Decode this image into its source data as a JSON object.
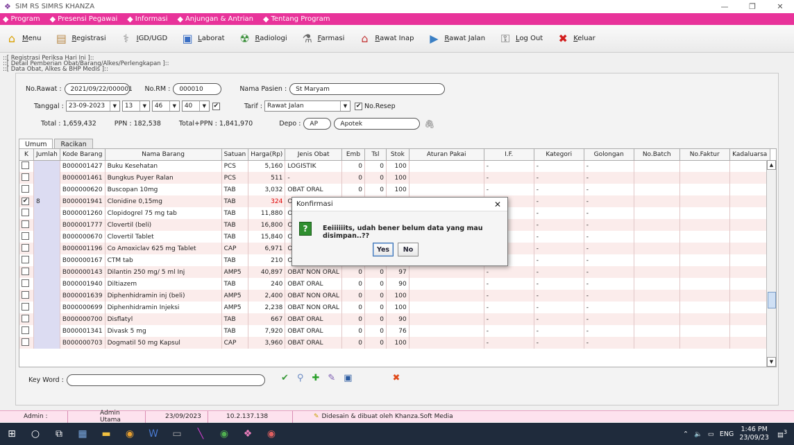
{
  "window": {
    "title": "SIM RS SIMRS KHANZA"
  },
  "menubar": [
    {
      "label": "Program",
      "icon": "program-icon"
    },
    {
      "label": "Presensi Pegawai",
      "icon": "user-icon"
    },
    {
      "label": "Informasi",
      "icon": "info-icon"
    },
    {
      "label": "Anjungan & Antrian",
      "icon": "kiosk-icon"
    },
    {
      "label": "Tentang Program",
      "icon": "about-icon"
    }
  ],
  "toolbar": [
    {
      "label": "Menu",
      "icon": "home-icon",
      "color": "#d9a000"
    },
    {
      "label": "Registrasi",
      "icon": "register-icon",
      "color": "#b98a4a"
    },
    {
      "label": "IGD/UGD",
      "icon": "emergency-icon",
      "color": "#8a8a8a"
    },
    {
      "label": "Laborat",
      "icon": "lab-icon",
      "color": "#3b6fc4"
    },
    {
      "label": "Radiologi",
      "icon": "radiology-icon",
      "color": "#3a8f3a"
    },
    {
      "label": "Farmasi",
      "icon": "pharmacy-icon",
      "color": "#6a6a6a"
    },
    {
      "label": "Rawat Inap",
      "icon": "inpatient-icon",
      "color": "#c43a3a"
    },
    {
      "label": "Rawat Jalan",
      "icon": "outpatient-icon",
      "color": "#3a7fc4"
    },
    {
      "label": "Log Out",
      "icon": "logout-icon",
      "color": "#555555"
    },
    {
      "label": "Keluar",
      "icon": "exit-icon",
      "color": "#d21e1e"
    }
  ],
  "breadcrumbs": [
    "::[ Registrasi Periksa Hari Ini ]::",
    "::[ Detail Pemberian Obat/Barang/Alkes/Perlengkapan ]::",
    "::[ Data Obat, Alkes & BHP Medis ]::"
  ],
  "form": {
    "no_rawat_label": "No.Rawat :",
    "no_rawat": "2021/09/22/000001",
    "no_rm_label": "No.RM :",
    "no_rm": "000010",
    "nama_label": "Nama Pasien :",
    "nama": "St Maryam",
    "tanggal_label": "Tanggal :",
    "tanggal": "23-09-2023",
    "jam": "13",
    "menit": "46",
    "detik": "40",
    "tarif_label": "Tarif :",
    "tarif": "Rawat Jalan",
    "noresep_label": "No.Resep",
    "total": "Total : 1,659,432",
    "ppn": "PPN : 182,538",
    "totalppn": "Total+PPN : 1,841,970",
    "depo_label": "Depo :",
    "depo_code": "AP",
    "depo_name": "Apotek"
  },
  "tabs": [
    "Umum",
    "Racikan"
  ],
  "table": {
    "headers": [
      "K",
      "Jumlah",
      "Kode Barang",
      "Nama Barang",
      "Satuan",
      "Harga(Rp)",
      "Jenis Obat",
      "Emb",
      "Tsl",
      "Stok",
      "Aturan Pakai",
      "I.F.",
      "Kategori",
      "Golongan",
      "No.Batch",
      "No.Faktur",
      "Kadaluarsa"
    ],
    "rows": [
      {
        "k": "",
        "jumlah": "",
        "kode": "B000001427",
        "nama": "Buku Kesehatan",
        "satuan": "PCS",
        "harga": "5,160",
        "jenis": "LOGISTIK",
        "emb": "0",
        "tsl": "0",
        "stok": "100",
        "aturan": "",
        "if": "-",
        "kategori": "-",
        "golongan": "-"
      },
      {
        "k": "",
        "jumlah": "",
        "kode": "B000001461",
        "nama": "Bungkus Puyer Ralan",
        "satuan": "PCS",
        "harga": "511",
        "jenis": "-",
        "emb": "0",
        "tsl": "0",
        "stok": "100",
        "aturan": "",
        "if": "-",
        "kategori": "-",
        "golongan": "-"
      },
      {
        "k": "",
        "jumlah": "",
        "kode": "B000000620",
        "nama": "Buscopan 10mg",
        "satuan": "TAB",
        "harga": "3,032",
        "jenis": "OBAT ORAL",
        "emb": "0",
        "tsl": "0",
        "stok": "100",
        "aturan": "",
        "if": "-",
        "kategori": "-",
        "golongan": "-"
      },
      {
        "k": "✔",
        "jumlah": "8",
        "kode": "B000001941",
        "nama": "Clonidine 0,15mg",
        "satuan": "TAB",
        "harga": "324",
        "jenis": "O",
        "emb": "",
        "tsl": "",
        "stok": "",
        "aturan": "",
        "if": "",
        "kategori": "-",
        "golongan": "-",
        "red": true
      },
      {
        "k": "",
        "jumlah": "",
        "kode": "B000001260",
        "nama": "Clopidogrel 75 mg tab",
        "satuan": "TAB",
        "harga": "11,880",
        "jenis": "O",
        "emb": "",
        "tsl": "",
        "stok": "",
        "aturan": "",
        "if": "",
        "kategori": "-",
        "golongan": "-"
      },
      {
        "k": "",
        "jumlah": "",
        "kode": "B000001777",
        "nama": "Clovertil (beli)",
        "satuan": "TAB",
        "harga": "16,800",
        "jenis": "O",
        "emb": "",
        "tsl": "",
        "stok": "",
        "aturan": "",
        "if": "",
        "kategori": "-",
        "golongan": "-"
      },
      {
        "k": "",
        "jumlah": "",
        "kode": "B000000670",
        "nama": "Clovertil Tablet",
        "satuan": "TAB",
        "harga": "15,840",
        "jenis": "O",
        "emb": "",
        "tsl": "",
        "stok": "",
        "aturan": "",
        "if": "",
        "kategori": "-",
        "golongan": "-"
      },
      {
        "k": "",
        "jumlah": "",
        "kode": "B000001196",
        "nama": "Co Amoxiclav 625 mg Tablet",
        "satuan": "CAP",
        "harga": "6,971",
        "jenis": "O",
        "emb": "",
        "tsl": "",
        "stok": "",
        "aturan": "",
        "if": "",
        "kategori": "-",
        "golongan": "-"
      },
      {
        "k": "",
        "jumlah": "",
        "kode": "B000000167",
        "nama": "CTM tab",
        "satuan": "TAB",
        "harga": "210",
        "jenis": "OBAT ORAL",
        "emb": "0",
        "tsl": "0",
        "stok": "1,000",
        "aturan": "",
        "if": "-",
        "kategori": "-",
        "golongan": "-"
      },
      {
        "k": "",
        "jumlah": "",
        "kode": "B000000143",
        "nama": "Dilantin 250 mg/ 5 ml Inj",
        "satuan": "AMP5",
        "harga": "40,897",
        "jenis": "OBAT NON ORAL",
        "emb": "0",
        "tsl": "0",
        "stok": "97",
        "aturan": "",
        "if": "-",
        "kategori": "-",
        "golongan": "-"
      },
      {
        "k": "",
        "jumlah": "",
        "kode": "B000001940",
        "nama": "Diltiazem",
        "satuan": "TAB",
        "harga": "240",
        "jenis": "OBAT ORAL",
        "emb": "0",
        "tsl": "0",
        "stok": "90",
        "aturan": "",
        "if": "-",
        "kategori": "-",
        "golongan": "-"
      },
      {
        "k": "",
        "jumlah": "",
        "kode": "B000001639",
        "nama": "Diphenhidramin inj (beli)",
        "satuan": "AMP5",
        "harga": "2,400",
        "jenis": "OBAT NON ORAL",
        "emb": "0",
        "tsl": "0",
        "stok": "100",
        "aturan": "",
        "if": "-",
        "kategori": "-",
        "golongan": "-"
      },
      {
        "k": "",
        "jumlah": "",
        "kode": "B000000699",
        "nama": "Diphenhidramin Injeksi",
        "satuan": "AMP5",
        "harga": "2,238",
        "jenis": "OBAT NON ORAL",
        "emb": "0",
        "tsl": "0",
        "stok": "100",
        "aturan": "",
        "if": "-",
        "kategori": "-",
        "golongan": "-"
      },
      {
        "k": "",
        "jumlah": "",
        "kode": "B000000700",
        "nama": "Disflatyl",
        "satuan": "TAB",
        "harga": "667",
        "jenis": "OBAT ORAL",
        "emb": "0",
        "tsl": "0",
        "stok": "90",
        "aturan": "",
        "if": "-",
        "kategori": "-",
        "golongan": "-"
      },
      {
        "k": "",
        "jumlah": "",
        "kode": "B000001341",
        "nama": "Divask 5 mg",
        "satuan": "TAB",
        "harga": "7,920",
        "jenis": "OBAT ORAL",
        "emb": "0",
        "tsl": "0",
        "stok": "76",
        "aturan": "",
        "if": "-",
        "kategori": "-",
        "golongan": "-"
      },
      {
        "k": "",
        "jumlah": "",
        "kode": "B000000703",
        "nama": "Dogmatil 50 mg Kapsul",
        "satuan": "CAP",
        "harga": "3,960",
        "jenis": "OBAT ORAL",
        "emb": "0",
        "tsl": "0",
        "stok": "100",
        "aturan": "",
        "if": "-",
        "kategori": "-",
        "golongan": "-"
      }
    ]
  },
  "keyword": {
    "label": "Key Word :",
    "value": ""
  },
  "dialog": {
    "title": "Konfirmasi",
    "message": "Eeiiiiiits, udah bener belum data yang mau disimpan..??",
    "yes": "Yes",
    "no": "No"
  },
  "statusbar": {
    "user": "Admin :",
    "role": "Admin Utama",
    "date": "23/09/2023",
    "ip": "10.2.137.138",
    "credit": "Didesain & dibuat oleh Khanza.Soft Media"
  },
  "taskbar": {
    "lang": "ENG",
    "time": "1:46 PM",
    "date": "23/09/23",
    "notif": "3"
  }
}
